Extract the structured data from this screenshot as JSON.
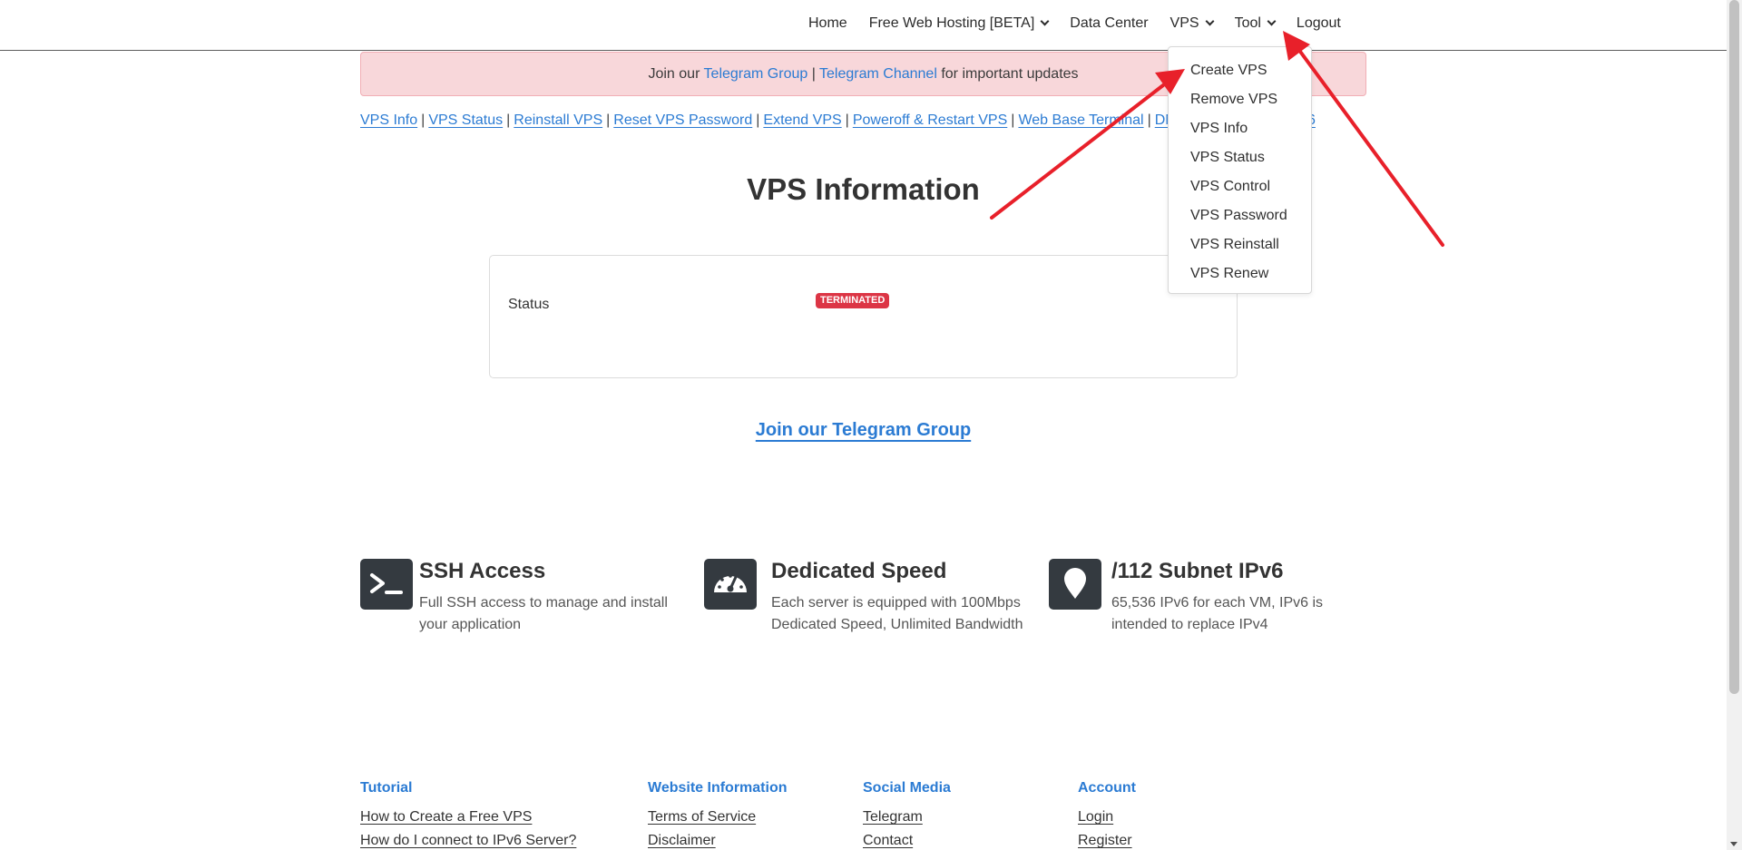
{
  "nav": {
    "home": "Home",
    "free_hosting": "Free Web Hosting [BETA]",
    "data_center": "Data Center",
    "vps": "VPS",
    "tool": "Tool",
    "logout": "Logout"
  },
  "dropdown": {
    "items": [
      "Create VPS",
      "Remove VPS",
      "VPS Info",
      "VPS Status",
      "VPS Control",
      "VPS Password",
      "VPS Reinstall",
      "VPS Renew"
    ]
  },
  "alert": {
    "prefix": "Join our ",
    "group": "Telegram Group",
    "sep": " | ",
    "channel": "Telegram Channel",
    "suffix": " for important updates"
  },
  "sublinks": [
    "VPS Info",
    "VPS Status",
    "Reinstall VPS",
    "Reset VPS Password",
    "Extend VPS",
    "Poweroff & Restart VPS",
    "Web Base Terminal",
    "DNS Po"
  ],
  "sublinks_tail": "6",
  "page_title": "VPS Information",
  "status": {
    "label": "Status",
    "badge": "TERMINATED"
  },
  "telegram_link": "Join our Telegram Group",
  "features": [
    {
      "title": "SSH Access",
      "text": "Full SSH access to manage and install your application",
      "icon": "terminal-icon"
    },
    {
      "title": "Dedicated Speed",
      "text": "Each server is equipped with 100Mbps Dedicated Speed, Unlimited Bandwidth",
      "icon": "speedometer-icon"
    },
    {
      "title": "/112 Subnet IPv6",
      "text": "65,536 IPv6 for each VM, IPv6 is intended to replace IPv4",
      "icon": "location-pin-icon"
    }
  ],
  "footer": {
    "tutorial": {
      "heading": "Tutorial",
      "links": [
        "How to Create a Free VPS",
        "How do I connect to IPv6 Server?"
      ]
    },
    "website": {
      "heading": "Website Information",
      "links": [
        "Terms of Service",
        "Disclaimer"
      ]
    },
    "social": {
      "heading": "Social Media",
      "links": [
        "Telegram",
        "Contact"
      ]
    },
    "account": {
      "heading": "Account",
      "links": [
        "Login",
        "Register"
      ]
    }
  },
  "colors": {
    "link": "#2b7bd3",
    "alert_bg": "#f8d7da",
    "badge": "#dc3545",
    "icon_bg": "#343a40",
    "arrow": "#e8202a"
  }
}
